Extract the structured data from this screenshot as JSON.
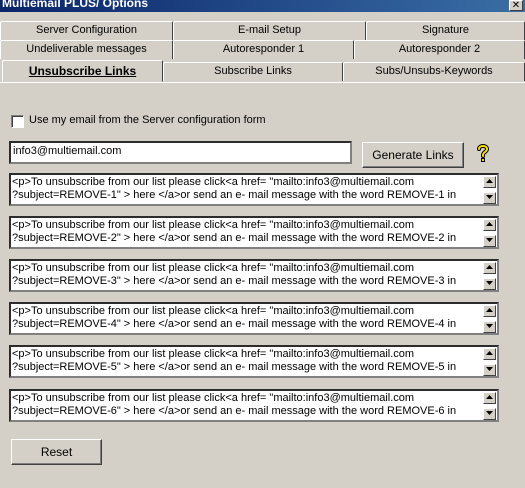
{
  "window": {
    "title": "Multiemail PLUS/ Options",
    "close_glyph": "✕"
  },
  "tabs": {
    "row1": [
      "Server Configuration",
      "E-mail Setup",
      "Signature"
    ],
    "row2": [
      "Undeliverable messages",
      "Autoresponder 1",
      "Autoresponder 2"
    ],
    "row3": [
      "Unsubscribe Links",
      "Subscribe Links",
      "Subs/Unsubs-Keywords"
    ],
    "active": "Unsubscribe Links"
  },
  "form": {
    "use_email_label": "Use my email from the Server configuration form",
    "use_email_checked": false,
    "email_value": "info3@multiemail.com",
    "generate_label": "Generate Links",
    "reset_label": "Reset",
    "help_icon": "question-mark-icon"
  },
  "memos": [
    "<p>To unsubscribe from our list please click<a href= \"mailto:info3@multiemail.com\n?subject=REMOVE-1\" > here </a>or send an e- mail message with the word REMOVE-1 in",
    "<p>To unsubscribe from our list please click<a href= \"mailto:info3@multiemail.com\n?subject=REMOVE-2\" > here </a>or send an e- mail message with the word REMOVE-2 in",
    "<p>To unsubscribe from our list please click<a href= \"mailto:info3@multiemail.com\n?subject=REMOVE-3\" > here </a>or send an e- mail message with the word REMOVE-3 in",
    "<p>To unsubscribe from our list please click<a href= \"mailto:info3@multiemail.com\n?subject=REMOVE-4\" > here </a>or send an e- mail message with the word REMOVE-4 in",
    "<p>To unsubscribe from our list please click<a href= \"mailto:info3@multiemail.com\n?subject=REMOVE-5\" > here </a>or send an e- mail message with the word REMOVE-5 in",
    "<p>To unsubscribe from our list please click<a href= \"mailto:info3@multiemail.com\n?subject=REMOVE-6\" > here </a>or send an e- mail message with the word REMOVE-6 in"
  ],
  "colors": {
    "face": "#d4d0c8",
    "title_start": "#0a246a",
    "title_end": "#3a6ea5",
    "help_yellow": "#f5e000"
  }
}
